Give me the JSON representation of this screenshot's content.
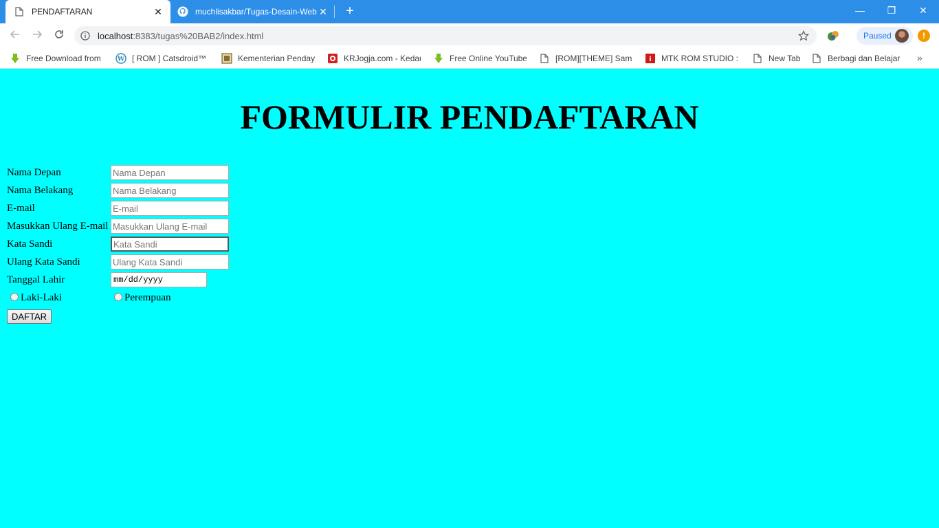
{
  "browser": {
    "tabs": [
      {
        "title": "PENDAFTARAN",
        "active": true,
        "icon": "page-icon"
      },
      {
        "title": "muchlisakbar/Tugas-Desain-Web",
        "active": false,
        "icon": "github-icon"
      }
    ],
    "new_tab_label": "+",
    "window_controls": {
      "minimize": "—",
      "restore": "❐",
      "close": "✕"
    },
    "address": {
      "host": "localhost",
      "rest": ":8383/tugas%20BAB2/index.html"
    },
    "profile_status": "Paused",
    "alert_label": "!",
    "bookmarks": [
      {
        "label": "Free Download from",
        "icon": "download-arrow-icon"
      },
      {
        "label": "[ ROM ] Catsdroid™ a",
        "icon": "wordpress-icon"
      },
      {
        "label": "Kementerian Pendayag",
        "icon": "government-emblem-icon"
      },
      {
        "label": "KRJogja.com - Kedaul",
        "icon": "krjogja-icon"
      },
      {
        "label": "Free Online YouTube",
        "icon": "download-arrow-icon"
      },
      {
        "label": "[ROM][THEME] Sams",
        "icon": "page-icon"
      },
      {
        "label": "MTK ROM STUDIO : C",
        "icon": "mtk-icon"
      },
      {
        "label": "New Tab",
        "icon": "page-icon"
      },
      {
        "label": "Berbagi dan Belajar",
        "icon": "page-icon"
      }
    ],
    "bookmarks_more": "»"
  },
  "page": {
    "heading": "FORMULIR PENDAFTARAN",
    "fields": [
      {
        "label": "Nama Depan",
        "placeholder": "Nama Depan"
      },
      {
        "label": "Nama Belakang",
        "placeholder": "Nama Belakang"
      },
      {
        "label": "E-mail",
        "placeholder": "E-mail"
      },
      {
        "label": "Masukkan Ulang E-mail",
        "placeholder": "Masukkan Ulang E-mail"
      },
      {
        "label": "Kata Sandi",
        "placeholder": "Kata Sandi"
      },
      {
        "label": "Ulang Kata Sandi",
        "placeholder": "Ulang Kata Sandi"
      }
    ],
    "birthdate": {
      "label": "Tanggal Lahir",
      "placeholder": "mm/dd/yyyy"
    },
    "gender": {
      "option_male": "Laki-Laki",
      "option_female": "Perempuan"
    },
    "submit_label": "DAFTAR"
  },
  "colors": {
    "page_background": "#00ffff",
    "tabbar": "#2d8ee8"
  }
}
